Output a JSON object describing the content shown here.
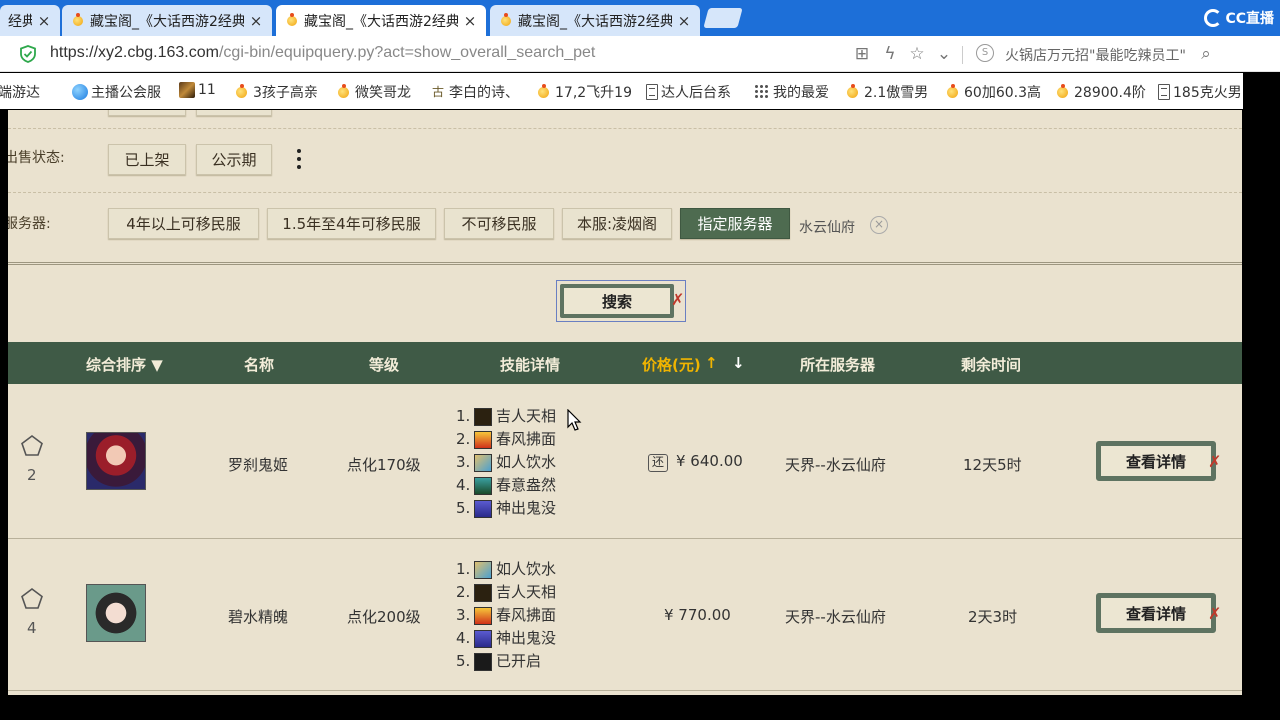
{
  "browser": {
    "tabs": [
      {
        "title": "经典",
        "close": "×"
      },
      {
        "title": "藏宝阁_《大话西游2经典",
        "close": "×"
      },
      {
        "title": "藏宝阁_《大话西游2经典",
        "close": "×"
      },
      {
        "title": "藏宝阁_《大话西游2经典",
        "close": "×"
      },
      {
        "title": "藏宝阁_《大话西游2经典",
        "close": "×"
      }
    ],
    "cc_logo": "CC直播",
    "url_main": "https://xy2.cbg.163.com",
    "url_rest": "/cgi-bin/equipquery.py?act=show_overall_search_pet",
    "news_ticker": "火锅店万元招\"最能吃辣员工\"",
    "bookmarks": [
      {
        "label": "端游达",
        "icon": "star-icon"
      },
      {
        "label": "主播公会服",
        "icon": "globe-icon"
      },
      {
        "label": "11",
        "icon": "image-icon"
      },
      {
        "label": "3孩子高亲",
        "icon": "star-icon"
      },
      {
        "label": "微笑哥龙",
        "icon": "star-icon"
      },
      {
        "label": "李白的诗、",
        "icon": "gu-icon"
      },
      {
        "label": "17,2飞升19",
        "icon": "star-icon"
      },
      {
        "label": "达人后台系",
        "icon": "doc-icon"
      },
      {
        "label": "我的最爱",
        "icon": "grid-icon"
      },
      {
        "label": "2.1傲雪男",
        "icon": "star-icon"
      },
      {
        "label": "60加60.3高",
        "icon": "star-icon"
      },
      {
        "label": "28900.4阶",
        "icon": "star-icon"
      },
      {
        "label": "185克火男",
        "icon": "doc-icon"
      }
    ]
  },
  "filters": {
    "sale_status_label": "出售状态:",
    "sale_status_options": [
      "已上架",
      "公示期"
    ],
    "server_label": "服务器:",
    "server_options": [
      "4年以上可移民服",
      "1.5年至4年可移民服",
      "不可移民服",
      "本服:凌烟阁",
      "指定服务器"
    ],
    "selected_server": "水云仙府",
    "clear_icon": "×"
  },
  "search": {
    "label": "搜索"
  },
  "table": {
    "headers": {
      "sort": "综合排序 ▼",
      "name": "名称",
      "level": "等级",
      "skills": "技能详情",
      "price": "价格(元)",
      "server": "所在服务器",
      "time_left": "剩余时间"
    },
    "rows": [
      {
        "fav_count": "2",
        "name": "罗刹鬼姬",
        "level": "点化170级",
        "skills": [
          "吉人天相",
          "春风拂面",
          "如人饮水",
          "春意盎然",
          "神出鬼没"
        ],
        "skill_numbers": [
          "1.",
          "2.",
          "3.",
          "4.",
          "5."
        ],
        "bargain_badge": "还",
        "price": "¥ 640.00",
        "server": "天界--水云仙府",
        "time_left": "12天5时",
        "detail_label": "查看详情"
      },
      {
        "fav_count": "4",
        "name": "碧水精魄",
        "level": "点化200级",
        "skills": [
          "如人饮水",
          "吉人天相",
          "春风拂面",
          "神出鬼没",
          "已开启"
        ],
        "skill_numbers": [
          "1.",
          "2.",
          "3.",
          "4.",
          "5."
        ],
        "price": "¥ 770.00",
        "server": "天界--水云仙府",
        "time_left": "2天3时",
        "detail_label": "查看详情"
      }
    ]
  },
  "colors": {
    "tab_bar": "#1d6fd8",
    "page_bg": "#eae2cf",
    "header_green": "#3f5a46",
    "selected_filter": "#4e6b50",
    "price_header": "#f0b400"
  }
}
